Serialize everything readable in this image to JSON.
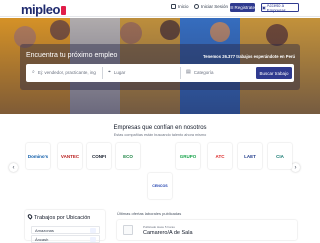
{
  "header": {
    "logo_text": "mipleo",
    "nav": [
      {
        "label": "Inicio",
        "icon": "home-icon"
      },
      {
        "label": "Iniciar Sesión",
        "icon": "user-icon"
      }
    ],
    "register_label": "Registrate",
    "company_label": "Acceso a Empresas",
    "brand_color": "#2f3a8f",
    "accent_color": "#e11d48"
  },
  "hero": {
    "title": "Encuentra tu próximo empleo",
    "count_text": "Tenemos 26.377 trabajos esperándote en Perú",
    "search": {
      "keyword_placeholder": "Ej: vendedor, practicante, ing",
      "location_placeholder": "Lugar",
      "category_placeholder": "Categoría",
      "button_label": "Buscar trabajo"
    }
  },
  "companies": {
    "title": "Empresas que confían en nosotros",
    "subtitle": "Estas compañías están buscando talento ahora mismo",
    "logos": [
      {
        "name": "Domino's",
        "color": "#0b5aa8"
      },
      {
        "name": "VANTEC",
        "color": "#b91c1c"
      },
      {
        "name": "CONFI",
        "color": "#111827"
      },
      {
        "name": "ECO",
        "color": "#15803d"
      },
      {
        "name": "GRUPO",
        "color": "#16a34a"
      },
      {
        "name": "ATC",
        "color": "#dc2626"
      },
      {
        "name": "LAET",
        "color": "#1e3a8a"
      },
      {
        "name": "CIA",
        "color": "#0f766e"
      },
      {
        "name": "CENCOS",
        "color": "#1e40af"
      }
    ]
  },
  "locations": {
    "title": "Trabajos por Ubicación",
    "items": [
      "Amazonas",
      "Áncash"
    ]
  },
  "offers": {
    "title": "Últimas ofertas laborales publicadas",
    "items": [
      {
        "date": "Publicado Hace 5 horas",
        "title": "Camarero/A de Sala"
      }
    ]
  }
}
